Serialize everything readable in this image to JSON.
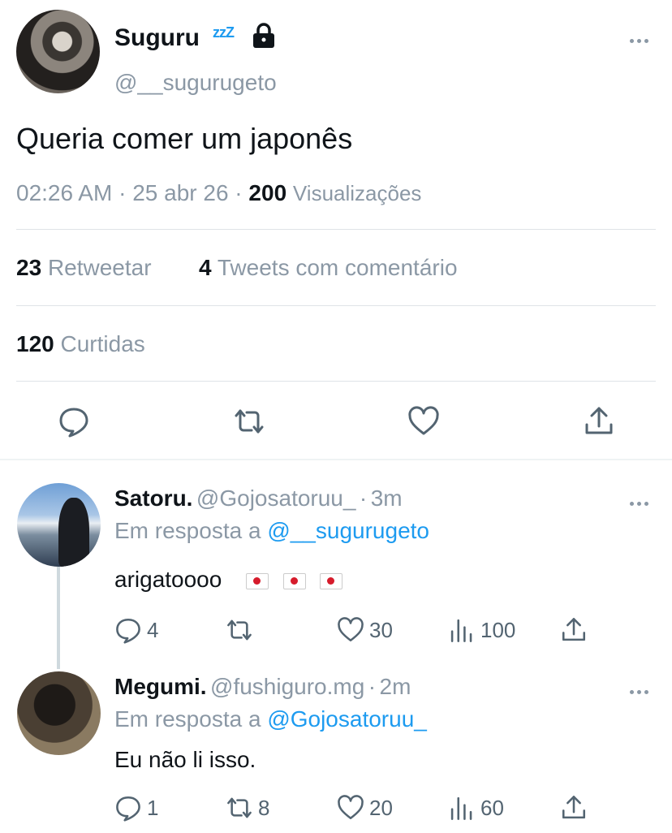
{
  "main_tweet": {
    "display_name": "Suguru",
    "sleep_emoji": "zzZ",
    "handle": "@__sugurugeto",
    "text": "Queria comer um japonês",
    "time": "02:26 AM",
    "date": "25 abr 26",
    "views_count": "200",
    "views_label": "Visualizações",
    "retweets_count": "23",
    "retweets_label": "Retweetar",
    "quotes_count": "4",
    "quotes_label": "Tweets com comentário",
    "likes_count": "120",
    "likes_label": "Curtidas"
  },
  "replies": [
    {
      "display_name": "Satoru.",
      "handle": "@Gojosatoruu_",
      "age": "3m",
      "reply_prefix": "Em resposta a",
      "reply_to": "@__sugurugeto",
      "text": "arigatoooo",
      "flags": [
        "flag-japan-icon",
        "flag-japan-icon",
        "flag-japan-icon"
      ],
      "replies": "4",
      "retweets": "",
      "likes": "30",
      "views": "100"
    },
    {
      "display_name": "Megumi.",
      "handle": "@fushiguro.mg",
      "age": "2m",
      "reply_prefix": "Em resposta a",
      "reply_to": "@Gojosatoruu_",
      "text": "Eu não li isso.",
      "replies": "1",
      "retweets": "8",
      "likes": "20",
      "views": "60"
    }
  ],
  "colors": {
    "accent": "#1d9bf0",
    "muted": "#8b98a5",
    "text": "#0f1419",
    "divider": "#dfe3e7"
  },
  "icons": [
    "lock-icon",
    "more-icon",
    "reply-icon",
    "retweet-icon",
    "like-icon",
    "share-icon",
    "views-icon"
  ]
}
